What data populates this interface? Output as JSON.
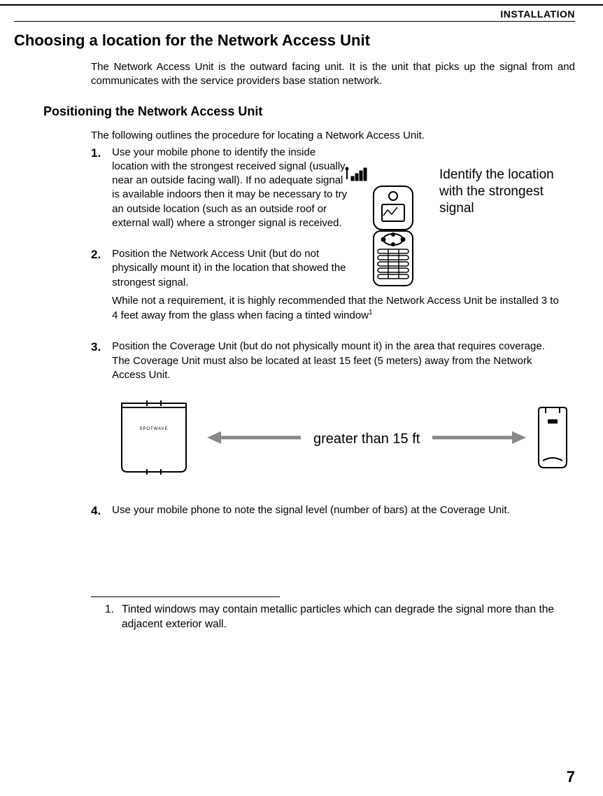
{
  "header": {
    "section": "INSTALLATION"
  },
  "title": "Choosing a location for the Network Access Unit",
  "intro": "The Network Access Unit is the outward facing unit. It is the unit that picks up the signal from and communicates with the service providers base station network.",
  "subsection": {
    "title": "Positioning the Network Access Unit",
    "intro": "The following outlines the procedure for locating a Network Access Unit."
  },
  "steps": {
    "s1": {
      "num": "1.",
      "text": "Use your mobile phone to identify the inside location with the strongest received signal (usually near an outside facing wall). If no adequate signal is available indoors then it may be necessary to try an outside location (such as an outside roof or external wall) where a stronger signal is received."
    },
    "s2": {
      "num": "2.",
      "text1": "Position the Network Access Unit (but do not physically mount it) in the location that showed the strongest signal.",
      "text2a": "While not a requirement, it is highly recommended that the Network Access Unit be installed 3 to 4 feet away from the glass when facing a tinted window",
      "sup": "1"
    },
    "s3": {
      "num": "3.",
      "text": "Position the Coverage Unit (but do not physically mount it) in the area that requires coverage. The Coverage Unit must also be located at least 15 feet (5 meters) away from the Network Access Unit."
    },
    "s4": {
      "num": "4.",
      "text": "Use your mobile phone to note the signal level (number of bars) at the Coverage Unit."
    }
  },
  "figure1": {
    "caption": "Identify the location with the strongest signal",
    "icon": "signal-bars-with-phone"
  },
  "figure2": {
    "label": "greater than 15 ft",
    "left_device": "coverage-unit",
    "right_device": "network-access-unit"
  },
  "footnote": {
    "num": "1.",
    "text": "Tinted windows may contain metallic particles which can degrade the signal more than the adjacent exterior wall."
  },
  "page_number": "7"
}
